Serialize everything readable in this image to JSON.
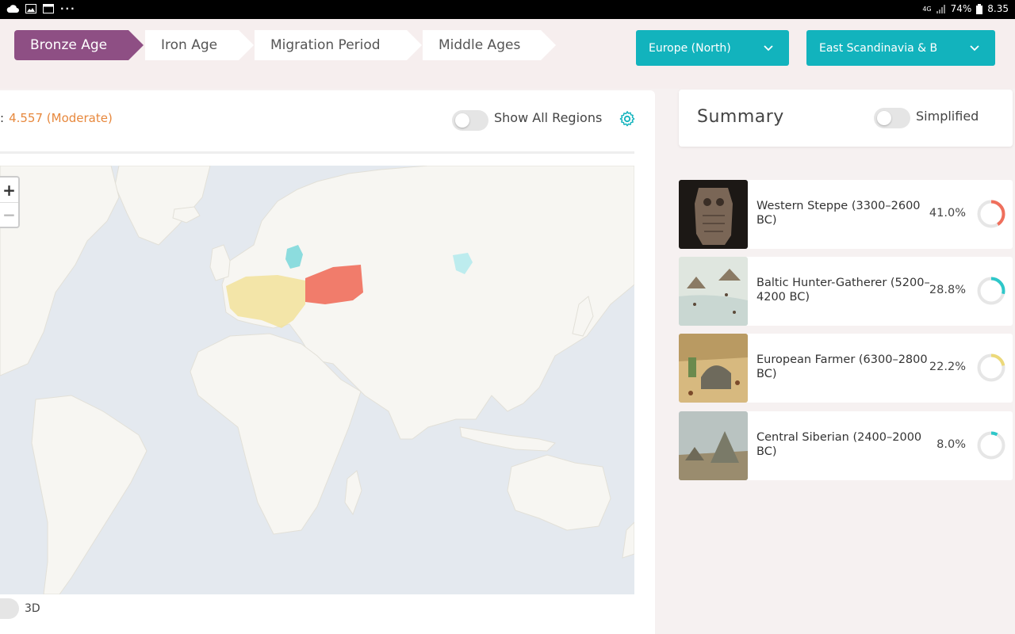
{
  "status_bar": {
    "network": "4G",
    "battery": "74%",
    "time": "8.35",
    "overflow_icon": "more-dots-icon"
  },
  "breadcrumbs": [
    {
      "label": "Bronze Age",
      "active": true
    },
    {
      "label": "Iron Age",
      "active": false
    },
    {
      "label": "Migration Period",
      "active": false
    },
    {
      "label": "Middle Ages",
      "active": false
    }
  ],
  "filters": {
    "region": "Europe (North)",
    "subregion": "East Scandinavia & B"
  },
  "map_panel": {
    "score": "4.557 (Moderate)",
    "show_all_regions_label": "Show All Regions",
    "zoom_in": "+",
    "zoom_out": "−",
    "view_3d_label": "3D"
  },
  "summary": {
    "title": "Summary",
    "simplified_label": "Simplified"
  },
  "ancestries": [
    {
      "name": "Western Steppe (3300–2600 BC)",
      "percent": "41.0%",
      "fraction": 0.41,
      "color": "#ef6f5c"
    },
    {
      "name": "Baltic Hunter-Gatherer (5200–4200 BC)",
      "percent": "28.8%",
      "fraction": 0.288,
      "color": "#2ec7c9"
    },
    {
      "name": "European Farmer (6300–2800 BC)",
      "percent": "22.2%",
      "fraction": 0.222,
      "color": "#ecd97a"
    },
    {
      "name": "Central Siberian (2400–2000 BC)",
      "percent": "8.0%",
      "fraction": 0.08,
      "color": "#2ec7c9"
    }
  ],
  "colors": {
    "accent": "#12b3bd",
    "breadcrumb_active": "#8e4f84",
    "score": "#e7883d",
    "steppe_region": "#ef6f5c",
    "hunter_gatherer_region": "#7fd9dc",
    "farmer_region": "#f2e29b"
  }
}
